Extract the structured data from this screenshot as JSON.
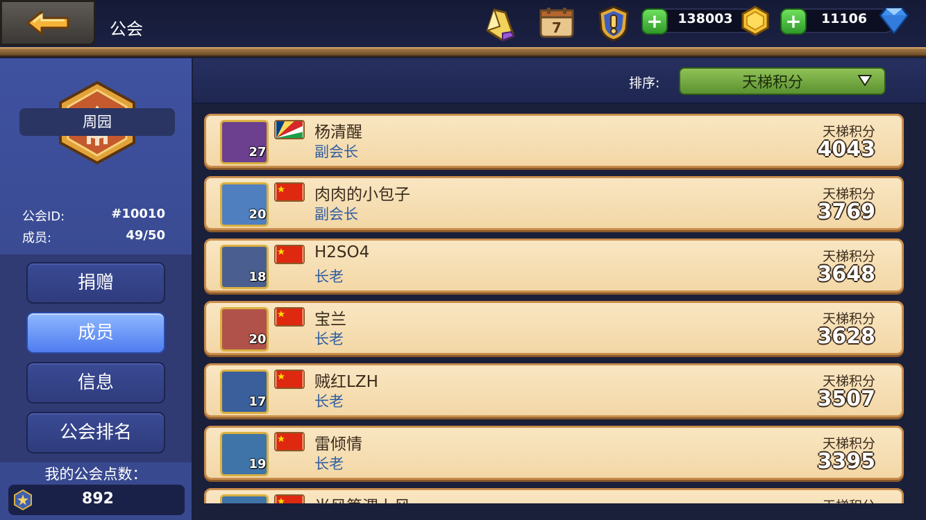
{
  "header": {
    "title": "公会",
    "icons": [
      "crystal-ticket-icon",
      "calendar-icon",
      "alert-shield-icon"
    ],
    "calendar_day": "7",
    "gold": {
      "value": "138003",
      "icon": "gold-coin-icon"
    },
    "gems": {
      "value": "11106",
      "icon": "blue-gem-icon"
    }
  },
  "guild": {
    "emblem_icon": "guild-emblem-icon",
    "name": "周园",
    "id_label": "公会ID:",
    "id_value": "#10010",
    "members_label": "成员:",
    "members_value": "49/50"
  },
  "nav": {
    "items": [
      {
        "label": "捐赠",
        "active": false
      },
      {
        "label": "成员",
        "active": true
      },
      {
        "label": "信息",
        "active": false
      },
      {
        "label": "公会排名",
        "active": false
      }
    ]
  },
  "points": {
    "label": "我的公会点数：",
    "value": "892"
  },
  "sort": {
    "label": "排序:",
    "value": "天梯积分"
  },
  "members": [
    {
      "name": "杨清醒",
      "role": "副会长",
      "level": "27",
      "score_label": "天梯积分",
      "score": "4043",
      "flag": "seychelles",
      "avatar_color": "#6c3f8f"
    },
    {
      "name": "肉肉的小包子",
      "role": "副会长",
      "level": "20",
      "score_label": "天梯积分",
      "score": "3769",
      "flag": "china",
      "avatar_color": "#4f7fbf"
    },
    {
      "name": "H2SO4",
      "role": "长老",
      "level": "18",
      "score_label": "天梯积分",
      "score": "3648",
      "flag": "china",
      "avatar_color": "#4a5f8f"
    },
    {
      "name": "宝兰",
      "role": "长老",
      "level": "20",
      "score_label": "天梯积分",
      "score": "3628",
      "flag": "china",
      "avatar_color": "#b0524a"
    },
    {
      "name": "贼红LZH",
      "role": "长老",
      "level": "17",
      "score_label": "天梯积分",
      "score": "3507",
      "flag": "china",
      "avatar_color": "#3a5f9a"
    },
    {
      "name": "雷倾情",
      "role": "长老",
      "level": "19",
      "score_label": "天梯积分",
      "score": "3395",
      "flag": "china",
      "avatar_color": "#3f74a8"
    },
    {
      "name": "当风箫渭上风",
      "role": "",
      "level": "",
      "score_label": "天梯积分",
      "score": "",
      "flag": "china",
      "avatar_color": "#3f74a8"
    }
  ]
}
